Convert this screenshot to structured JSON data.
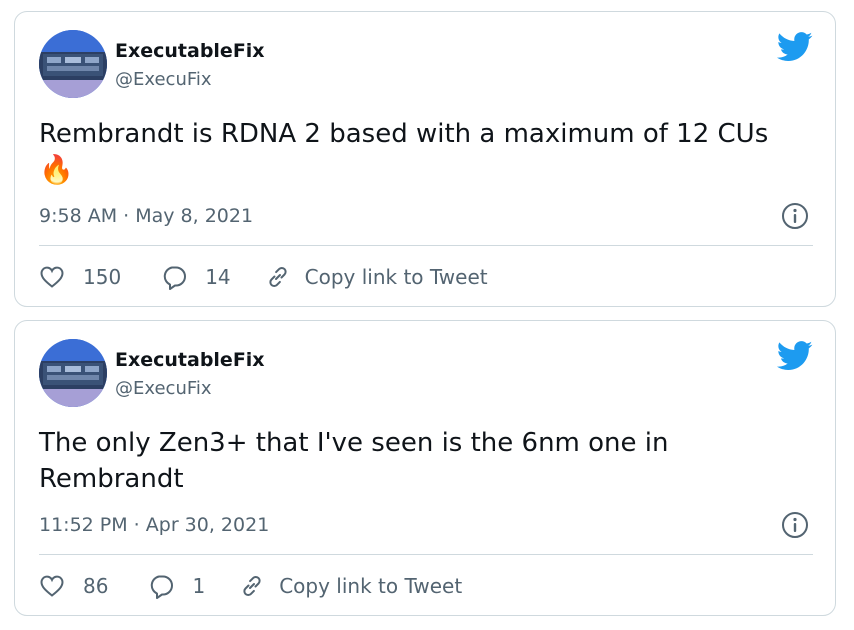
{
  "tweets": [
    {
      "author": {
        "name": "ExecutableFix",
        "handle": "@ExecuFix"
      },
      "text": "Rembrandt is RDNA 2 based with a maximum of 12 CUs",
      "emoji": "🔥",
      "timestamp": "9:58 AM · May 8, 2021",
      "likes": "150",
      "replies": "14",
      "copy_link_label": "Copy link to Tweet"
    },
    {
      "author": {
        "name": "ExecutableFix",
        "handle": "@ExecuFix"
      },
      "text": "The only Zen3+ that I've seen is the 6nm one in Rembrandt",
      "emoji": "",
      "timestamp": "11:52 PM · Apr 30, 2021",
      "likes": "86",
      "replies": "1",
      "copy_link_label": "Copy link to Tweet"
    }
  ],
  "colors": {
    "brand": "#1d9bf0",
    "text": "#0f1419",
    "secondary": "#536471",
    "border": "#cfd9de"
  },
  "icons": [
    "twitter-bird-icon",
    "info-icon",
    "heart-icon",
    "reply-icon",
    "link-icon"
  ]
}
